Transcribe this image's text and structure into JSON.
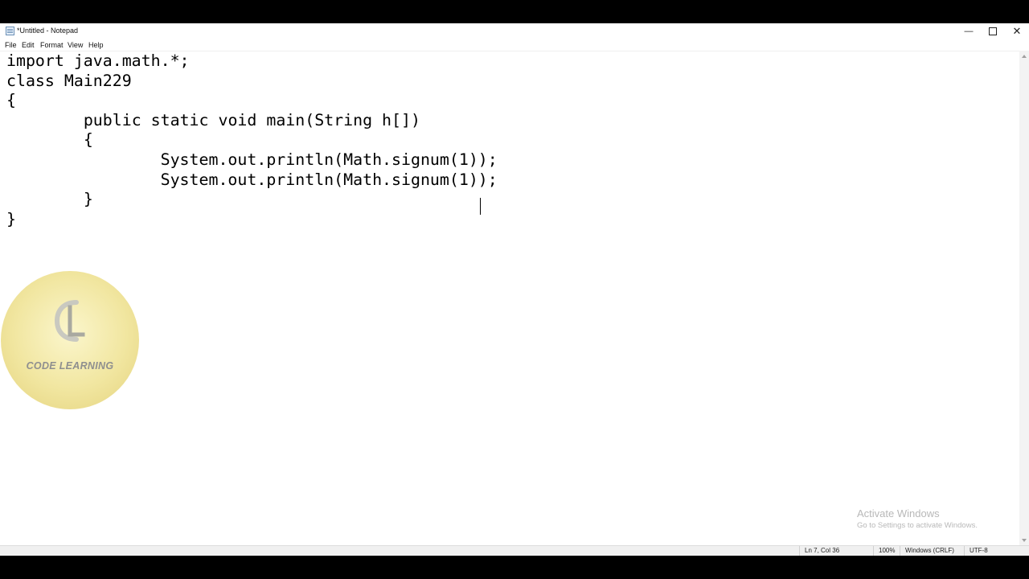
{
  "window": {
    "title": "*Untitled - Notepad"
  },
  "menu": [
    {
      "label": "File"
    },
    {
      "label": "Edit"
    },
    {
      "label": "Format"
    },
    {
      "label": "View"
    },
    {
      "label": "Help"
    }
  ],
  "editor": {
    "lines": [
      "import java.math.*;",
      "class Main229",
      "{",
      "\tpublic static void main(String h[])",
      "\t{",
      "\t\tSystem.out.println(Math.signum(1));",
      "\t\tSystem.out.println(Math.signum(1));",
      "\t}",
      "}"
    ]
  },
  "status": {
    "position": "Ln 7, Col 36",
    "zoom": "100%",
    "line_endings": "Windows (CRLF)",
    "encoding": "UTF-8"
  },
  "watermark": {
    "title": "Activate Windows",
    "subtitle": "Go to Settings to activate Windows."
  },
  "logo": {
    "text": "CODE LEARNING",
    "mark": "CL"
  },
  "icons": {
    "app": "notepad-icon",
    "minimize": "minimize-icon",
    "maximize": "maximize-icon",
    "close": "close-icon"
  }
}
